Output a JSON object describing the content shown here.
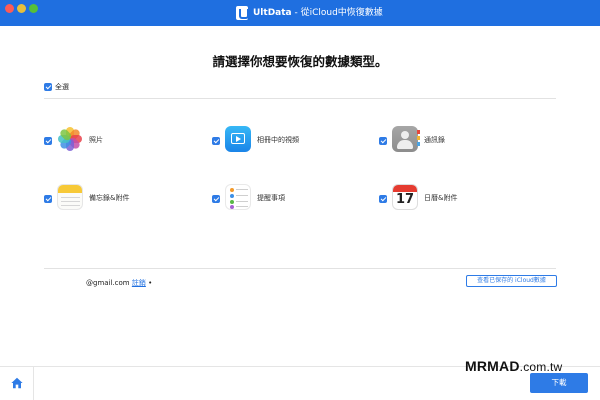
{
  "window": {
    "app_name": "UltData",
    "title_suffix": " - 從iCloud中恢復數據"
  },
  "heading": "請選擇你想要恢復的數據類型。",
  "select_all": {
    "label": "全選",
    "checked": true
  },
  "data_types": [
    {
      "label": "照片",
      "icon": "photos-icon",
      "checked": true
    },
    {
      "label": "相冊中的視頻",
      "icon": "album-video-icon",
      "checked": true
    },
    {
      "label": "通訊錄",
      "icon": "contacts-icon",
      "checked": true
    },
    {
      "label": "備忘錄&附件",
      "icon": "notes-icon",
      "checked": true
    },
    {
      "label": "提醒事項",
      "icon": "reminders-icon",
      "checked": true
    },
    {
      "label": "日曆&附件",
      "icon": "calendar-icon",
      "checked": true
    }
  ],
  "calendar_day": "17",
  "account": {
    "email": "@gmail.com",
    "logout_label": "註銷",
    "trailing": " •"
  },
  "view_saved_label": "查看已保存的 iCloud數據",
  "watermark": {
    "brand": "MRMAD",
    "domain": ".com.tw"
  },
  "download_label": "下載",
  "colors": {
    "accent": "#2e7be6",
    "titlebar": "#1f6fe0"
  }
}
